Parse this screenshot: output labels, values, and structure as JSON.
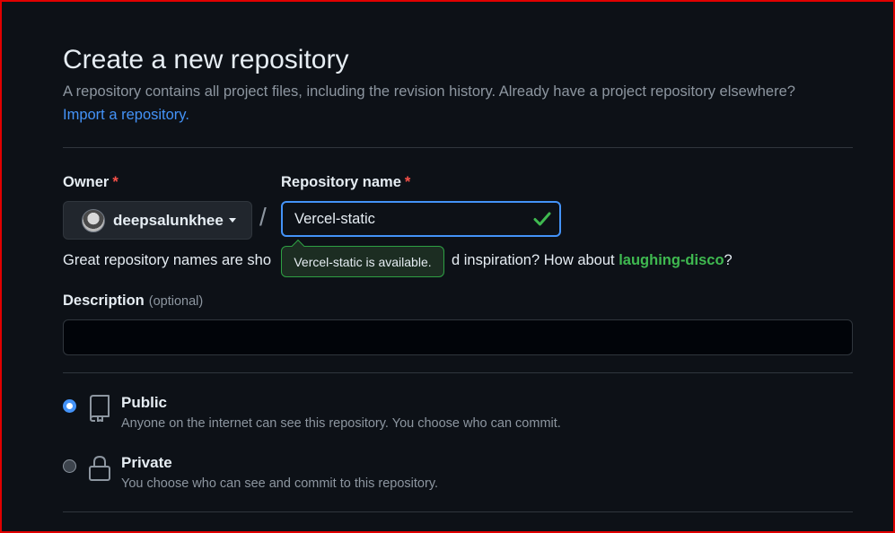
{
  "header": {
    "title": "Create a new repository",
    "subtitle": "A repository contains all project files, including the revision history. Already have a project repository elsewhere?",
    "import_link": "Import a repository."
  },
  "owner": {
    "label": "Owner",
    "required_mark": "*",
    "value": "deepsalunkhee"
  },
  "separator": "/",
  "repo_name": {
    "label": "Repository name",
    "required_mark": "*",
    "value": "Vercel-static",
    "tooltip": "Vercel-static is available."
  },
  "name_hint": {
    "prefix": "Great repository names are sho",
    "middle": "d inspiration? How about ",
    "suggestion": "laughing-disco",
    "suffix": "?"
  },
  "description": {
    "label": "Description",
    "optional": "(optional)",
    "value": ""
  },
  "visibility": {
    "options": [
      {
        "title": "Public",
        "description": "Anyone on the internet can see this repository. You choose who can commit.",
        "selected": true,
        "icon": "repo-icon"
      },
      {
        "title": "Private",
        "description": "You choose who can see and commit to this repository.",
        "selected": false,
        "icon": "lock-icon"
      }
    ]
  },
  "colors": {
    "accent": "#4493f8",
    "success": "#3fb950",
    "danger": "#f85149",
    "background": "#0d1117"
  }
}
